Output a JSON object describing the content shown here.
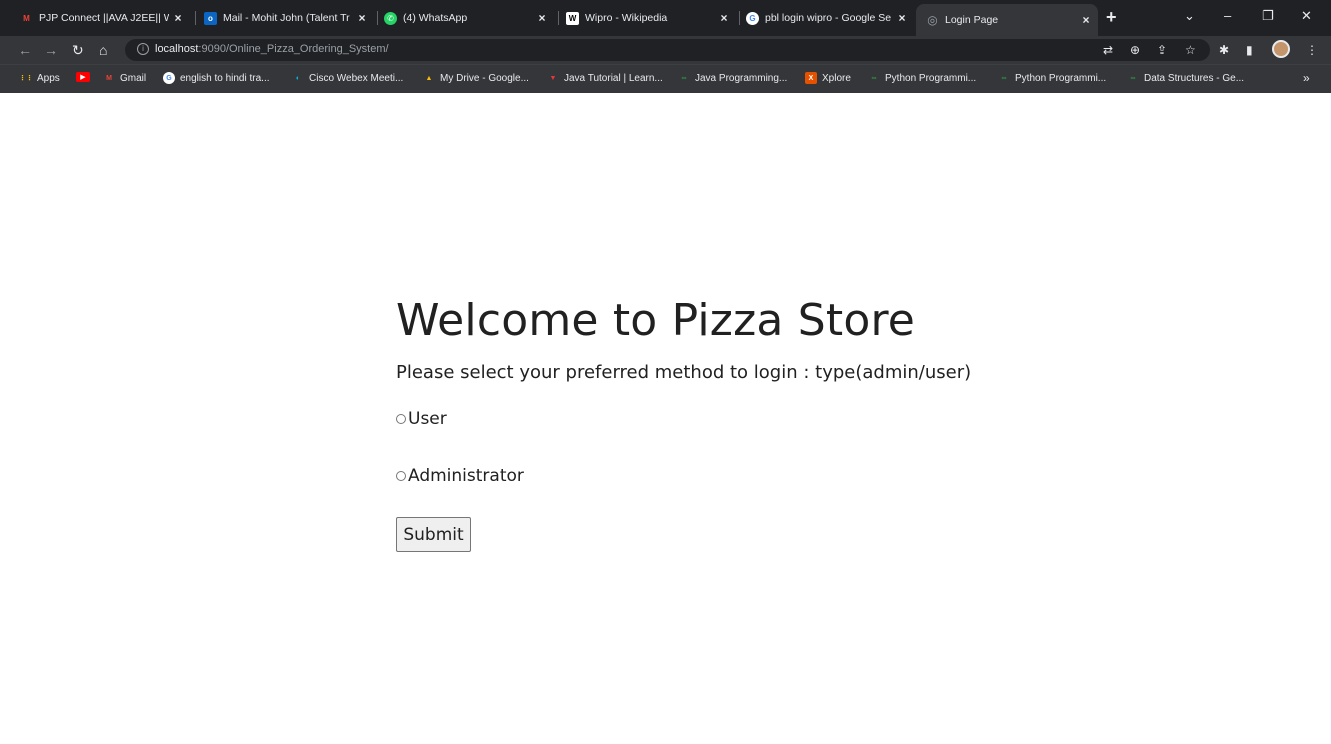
{
  "tabs": [
    {
      "title": "PJP Connect ||AVA J2EE|| W",
      "favicon": "M",
      "favicon_color": "#ea4335"
    },
    {
      "title": "Mail - Mohit John (Talent Tr",
      "favicon": "o",
      "favicon_color": "#0a66c2"
    },
    {
      "title": "(4) WhatsApp",
      "favicon": "✆",
      "favicon_color": "#25d366"
    },
    {
      "title": "Wipro - Wikipedia",
      "favicon": "W",
      "favicon_color": "#ffffff"
    },
    {
      "title": "pbl login wipro - Google Se",
      "favicon": "G",
      "favicon_color": "#4285f4"
    },
    {
      "title": "Login Page",
      "favicon": "◎",
      "favicon_color": "#9aa0a6"
    }
  ],
  "address_bar": {
    "host": "localhost",
    "path": ":9090/Online_Pizza_Ordering_System/"
  },
  "bookmarks": [
    {
      "label": "Apps",
      "favicon": "⋮⋮",
      "color": "#fbbc04"
    },
    {
      "label": "",
      "favicon": "▶",
      "color": "#ff0000"
    },
    {
      "label": "Gmail",
      "favicon": "M",
      "color": "#ea4335"
    },
    {
      "label": "english to hindi tra...",
      "favicon": "G",
      "color": "#4285f4"
    },
    {
      "label": "Cisco Webex Meeti...",
      "favicon": "◐",
      "color": "#00bceb"
    },
    {
      "label": "My Drive - Google...",
      "favicon": "▲",
      "color": "#fbbc04"
    },
    {
      "label": "Java Tutorial | Learn...",
      "favicon": "▼",
      "color": "#e53935"
    },
    {
      "label": "Java Programming...",
      "favicon": "∞",
      "color": "#2f8d46"
    },
    {
      "label": "Xplore",
      "favicon": "X",
      "color": "#e65100"
    },
    {
      "label": "Python Programmi...",
      "favicon": "∞",
      "color": "#2f8d46"
    },
    {
      "label": "Python Programmi...",
      "favicon": "∞",
      "color": "#2f8d46"
    },
    {
      "label": "Data Structures - Ge...",
      "favicon": "∞",
      "color": "#2f8d46"
    }
  ],
  "page": {
    "heading": "Welcome to Pizza Store",
    "subtitle": "Please select your preferred method to login : type(admin/user)",
    "options": [
      "User",
      "Administrator"
    ],
    "submit_label": "Submit"
  }
}
